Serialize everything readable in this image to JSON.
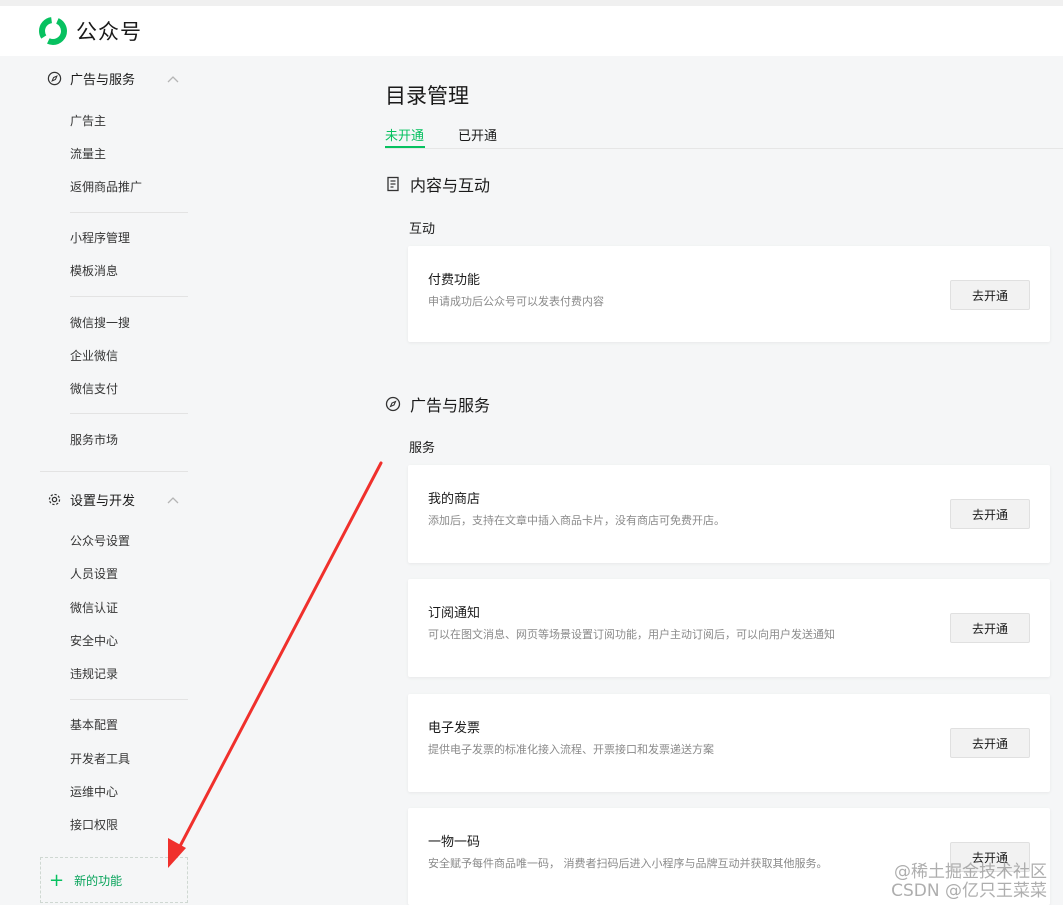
{
  "app": {
    "name": "公众号",
    "brand_color": "#07c160",
    "logo_icon": "wechat-official-logo-icon"
  },
  "sidebar": {
    "group_ad": {
      "label": "广告与服务",
      "icon": "compass-icon",
      "items": [
        "广告主",
        "流量主",
        "返佣商品推广",
        "小程序管理",
        "模板消息",
        "微信搜一搜",
        "企业微信",
        "微信支付",
        "服务市场"
      ]
    },
    "group_settings": {
      "label": "设置与开发",
      "icon": "gear-icon",
      "items": [
        "公众号设置",
        "人员设置",
        "微信认证",
        "安全中心",
        "违规记录",
        "基本配置",
        "开发者工具",
        "运维中心",
        "接口权限"
      ]
    },
    "new_feature": "新的功能"
  },
  "main": {
    "title": "目录管理",
    "tabs": [
      {
        "label": "未开通",
        "active": true
      },
      {
        "label": "已开通",
        "active": false
      }
    ],
    "sections": [
      {
        "title": "内容与互动",
        "icon": "document-icon",
        "subtitle": "互动",
        "cards": [
          {
            "title": "付费功能",
            "desc": "申请成功后公众号可以发表付费内容",
            "button": "去开通"
          }
        ]
      },
      {
        "title": "广告与服务",
        "icon": "compass-icon",
        "subtitle": "服务",
        "cards": [
          {
            "title": "我的商店",
            "desc": "添加后，支持在文章中插入商品卡片，没有商店可免费开店。",
            "button": "去开通"
          },
          {
            "title": "订阅通知",
            "desc": "可以在图文消息、网页等场景设置订阅功能，用户主动订阅后，可以向用户发送通知",
            "button": "去开通"
          },
          {
            "title": "电子发票",
            "desc": "提供电子发票的标准化接入流程、开票接口和发票递送方案",
            "button": "去开通"
          },
          {
            "title": "一物一码",
            "desc": "安全赋予每件商品唯一码， 消费者扫码后进入小程序与品牌互动并获取其他服务。",
            "button": "去开通"
          }
        ]
      }
    ]
  },
  "annotation": {
    "arrow_color": "#f0302c"
  },
  "watermark": {
    "line1": "@稀土掘金技术社区",
    "line2": "CSDN @亿只王菜菜"
  }
}
